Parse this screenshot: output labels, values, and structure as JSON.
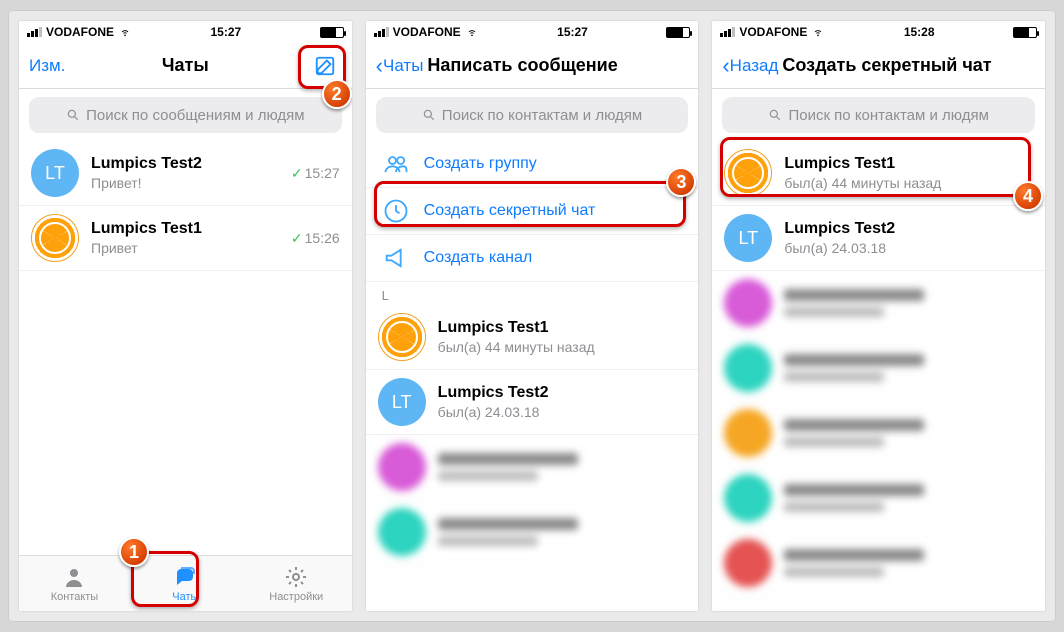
{
  "screens": {
    "s1": {
      "status": {
        "carrier": "VODAFONE",
        "time": "15:27"
      },
      "nav": {
        "left": "Изм.",
        "title": "Чаты"
      },
      "search_placeholder": "Поиск по сообщениям и людям",
      "chats": [
        {
          "name": "Lumpics Test2",
          "sub": "Привет!",
          "time": "15:27",
          "initials": "LT"
        },
        {
          "name": "Lumpics Test1",
          "sub": "Привет",
          "time": "15:26"
        }
      ],
      "tabs": {
        "contacts": "Контакты",
        "chats": "Чаты",
        "settings": "Настройки"
      },
      "badge1": "1",
      "badge2": "2"
    },
    "s2": {
      "status": {
        "carrier": "VODAFONE",
        "time": "15:27"
      },
      "nav": {
        "back": "Чаты",
        "title": "Написать сообщение"
      },
      "search_placeholder": "Поиск по контактам и людям",
      "options": {
        "group": "Создать группу",
        "secret": "Создать секретный чат",
        "channel": "Создать канал"
      },
      "section": "L",
      "contacts": [
        {
          "name": "Lumpics Test1",
          "sub": "был(а) 44 минуты назад"
        },
        {
          "name": "Lumpics Test2",
          "sub": "был(а) 24.03.18",
          "initials": "LT"
        }
      ],
      "badge3": "3"
    },
    "s3": {
      "status": {
        "carrier": "VODAFONE",
        "time": "15:28"
      },
      "nav": {
        "back": "Назад",
        "title": "Создать секретный чат"
      },
      "search_placeholder": "Поиск по контактам и людям",
      "contacts": [
        {
          "name": "Lumpics Test1",
          "sub": "был(а) 44 минуты назад"
        },
        {
          "name": "Lumpics Test2",
          "sub": "был(а) 24.03.18",
          "initials": "LT"
        }
      ],
      "badge4": "4"
    }
  }
}
